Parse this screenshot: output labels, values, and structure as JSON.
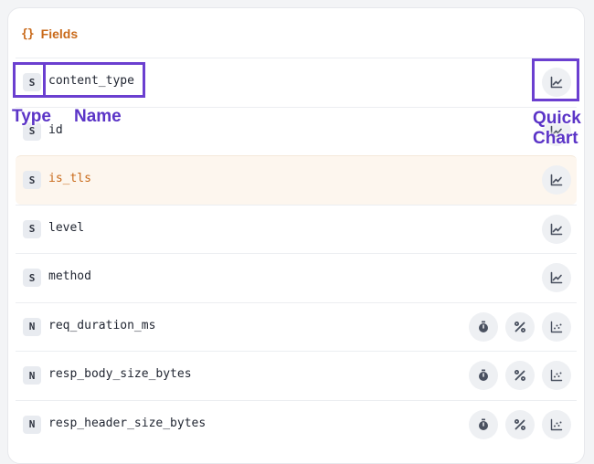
{
  "panel": {
    "brace_icon": "{}",
    "title": "Fields"
  },
  "fields": [
    {
      "type": "S",
      "name": "content_type",
      "actions": [
        "quick-chart"
      ]
    },
    {
      "type": "S",
      "name": "id",
      "actions": [
        "quick-chart"
      ]
    },
    {
      "type": "S",
      "name": "is_tls",
      "actions": [
        "quick-chart"
      ],
      "highlighted": true
    },
    {
      "type": "S",
      "name": "level",
      "actions": [
        "quick-chart"
      ]
    },
    {
      "type": "S",
      "name": "method",
      "actions": [
        "quick-chart"
      ]
    },
    {
      "type": "N",
      "name": "req_duration_ms",
      "actions": [
        "timer",
        "percent",
        "scatter"
      ]
    },
    {
      "type": "N",
      "name": "resp_body_size_bytes",
      "actions": [
        "timer",
        "percent",
        "scatter"
      ]
    },
    {
      "type": "N",
      "name": "resp_header_size_bytes",
      "actions": [
        "timer",
        "percent",
        "scatter"
      ]
    }
  ],
  "annotations": {
    "type_label": "Type",
    "name_label": "Name",
    "quick_label_line1": "Quick",
    "quick_label_line2": "Chart",
    "color": "#6b3fd0"
  },
  "colors": {
    "accent": "#c96a1a",
    "highlight_row": "#fdf6ee",
    "badge_bg": "#e8ebf0",
    "action_bg": "#eef0f3"
  }
}
